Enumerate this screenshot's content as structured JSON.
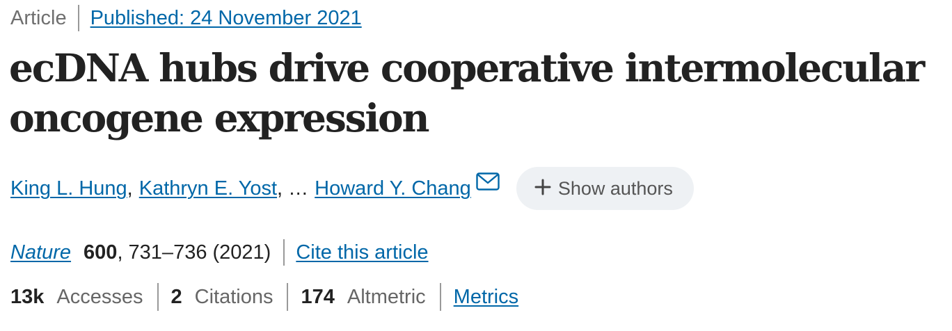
{
  "meta": {
    "article_type": "Article",
    "published": "Published: 24 November 2021"
  },
  "title": {
    "line1": "ecDNA hubs drive cooperative intermolecular",
    "line2": "oncogene expression"
  },
  "authors": {
    "author1": "King L. Hung",
    "comma1": ",",
    "author2": "Kathryn E. Yost",
    "ellipsis": ", …",
    "author3": "Howard Y. Chang",
    "show_authors_label": "Show authors",
    "mail_icon": "mail-icon",
    "plus_icon": "plus-icon"
  },
  "journal": {
    "name": "Nature",
    "volume": "600",
    "pages_year": ", 731–736 (2021)",
    "cite_label": "Cite this article"
  },
  "metrics": {
    "accesses_count": "13k",
    "accesses_label": "Accesses",
    "citations_count": "2",
    "citations_label": "Citations",
    "altmetric_count": "174",
    "altmetric_label": "Altmetric",
    "metrics_link": "Metrics"
  },
  "colors": {
    "link": "#0067a8",
    "text": "#222222",
    "muted": "#6f6f6f",
    "pill_bg": "#eef1f4"
  }
}
